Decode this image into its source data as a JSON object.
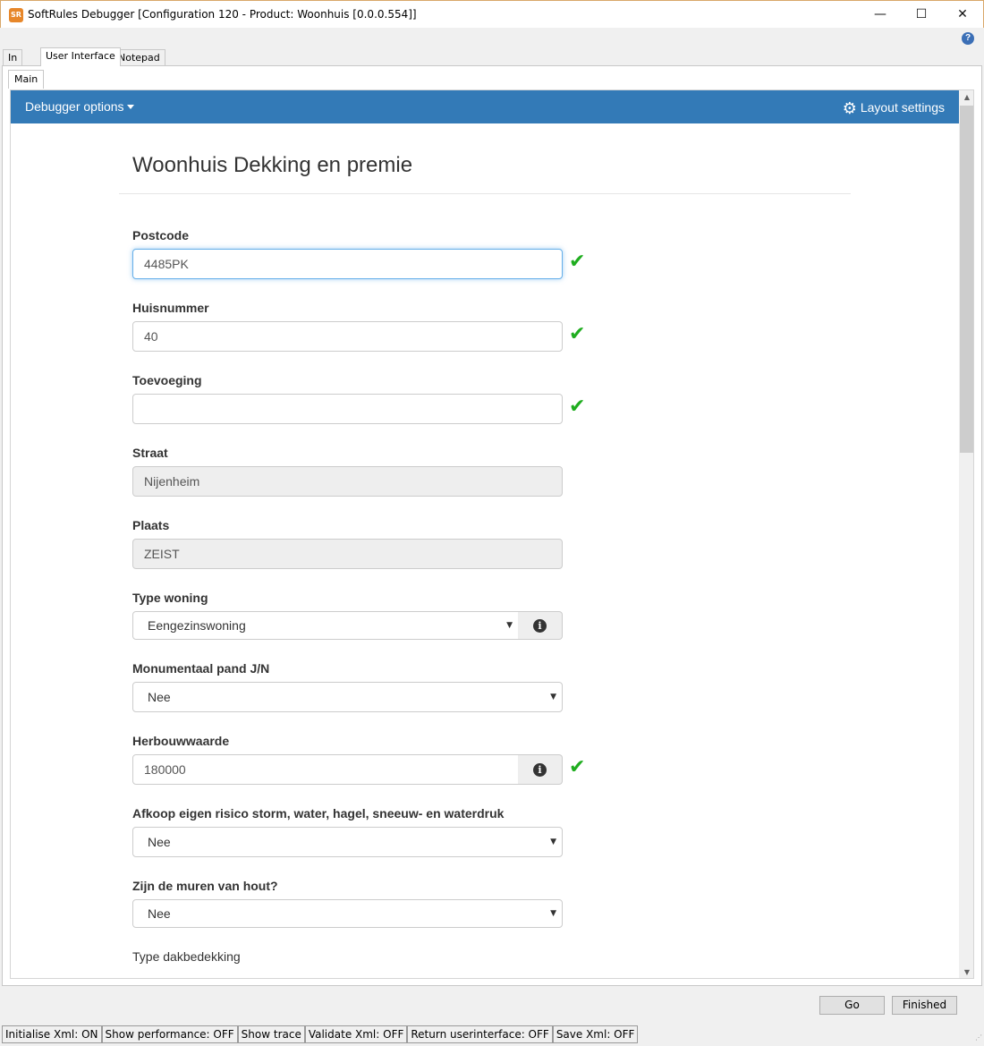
{
  "window": {
    "title": "SoftRules Debugger [Configuration 120 - Product: Woonhuis [0.0.0.554]]",
    "app_icon": "SR",
    "minimize": "—",
    "maximize": "☐",
    "close": "✕",
    "help": "?"
  },
  "tabs": [
    {
      "label": "In"
    },
    {
      "label": "User Interface"
    },
    {
      "label": "Notepad"
    }
  ],
  "subtab": {
    "label": "Main"
  },
  "navbar": {
    "debugger_options": "Debugger options",
    "layout_settings": "Layout settings",
    "color": "#337ab7"
  },
  "form": {
    "title": "Woonhuis Dekking en premie",
    "fields": {
      "postcode": {
        "label": "Postcode",
        "value": "4485PK",
        "valid": true
      },
      "huisnummer": {
        "label": "Huisnummer",
        "value": "40",
        "valid": true
      },
      "toevoeging": {
        "label": "Toevoeging",
        "value": "",
        "valid": true
      },
      "straat": {
        "label": "Straat",
        "value": "Nijenheim"
      },
      "plaats": {
        "label": "Plaats",
        "value": "ZEIST"
      },
      "type_woning": {
        "label": "Type woning",
        "value": "Eengezinswoning"
      },
      "monumentaal": {
        "label": "Monumentaal pand J/N",
        "value": "Nee"
      },
      "herbouwwaarde": {
        "label": "Herbouwwaarde",
        "value": "180000",
        "valid": true
      },
      "afkoop": {
        "label": "Afkoop eigen risico storm, water, hagel, sneeuw- en waterdruk",
        "value": "Nee"
      },
      "muren_hout": {
        "label": "Zijn de muren van hout?",
        "value": "Nee"
      },
      "dakbedekking": {
        "label": "Type dakbedekking"
      }
    },
    "check_glyph": "✔",
    "info_glyph": "i",
    "check_color": "#1fad1f"
  },
  "buttons": {
    "go": "Go",
    "finished": "Finished"
  },
  "status": [
    "Initialise Xml: ON",
    "Show performance: OFF",
    "Show trace",
    "Validate Xml: OFF",
    "Return userinterface: OFF",
    "Save Xml: OFF"
  ]
}
